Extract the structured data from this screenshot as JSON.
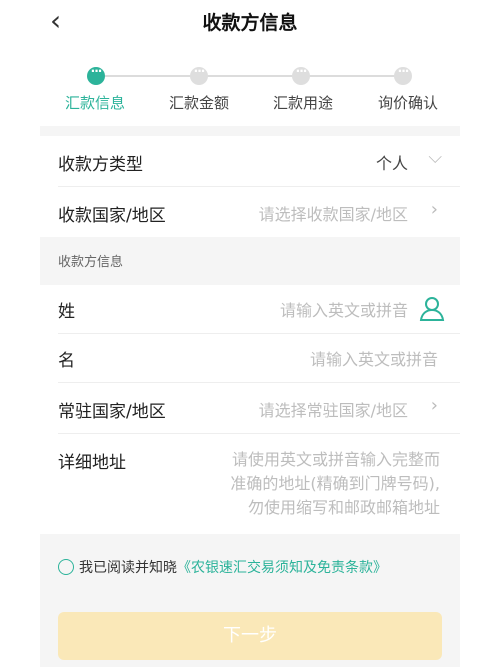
{
  "header": {
    "back_icon": "chevron-left-icon",
    "title": "收款方信息"
  },
  "steps": [
    {
      "label": "汇款信息",
      "active": true
    },
    {
      "label": "汇款金额",
      "active": false
    },
    {
      "label": "汇款用途",
      "active": false
    },
    {
      "label": "询价确认",
      "active": false
    }
  ],
  "form": {
    "payee_type": {
      "label": "收款方类型",
      "value": "个人"
    },
    "payee_country": {
      "label": "收款国家/地区",
      "placeholder": "请选择收款国家/地区"
    },
    "section_title": "收款方信息",
    "surname": {
      "label": "姓",
      "placeholder": "请输入英文或拼音"
    },
    "given_name": {
      "label": "名",
      "placeholder": "请输入英文或拼音"
    },
    "residence_country": {
      "label": "常驻国家/地区",
      "placeholder": "请选择常驻国家/地区"
    },
    "address": {
      "label": "详细地址",
      "placeholder_lines": [
        "请使用英文或拼音输入完整而",
        "准确的地址(精确到门牌号码),",
        "勿使用缩写和邮政邮箱地址"
      ]
    }
  },
  "agreement": {
    "text": "我已阅读并知晓",
    "link": "《农银速汇交易须知及免责条款》"
  },
  "next_button": "下一步",
  "colors": {
    "accent": "#2cb39a",
    "button_disabled": "#fae8b8",
    "placeholder": "#bdbdbd"
  }
}
